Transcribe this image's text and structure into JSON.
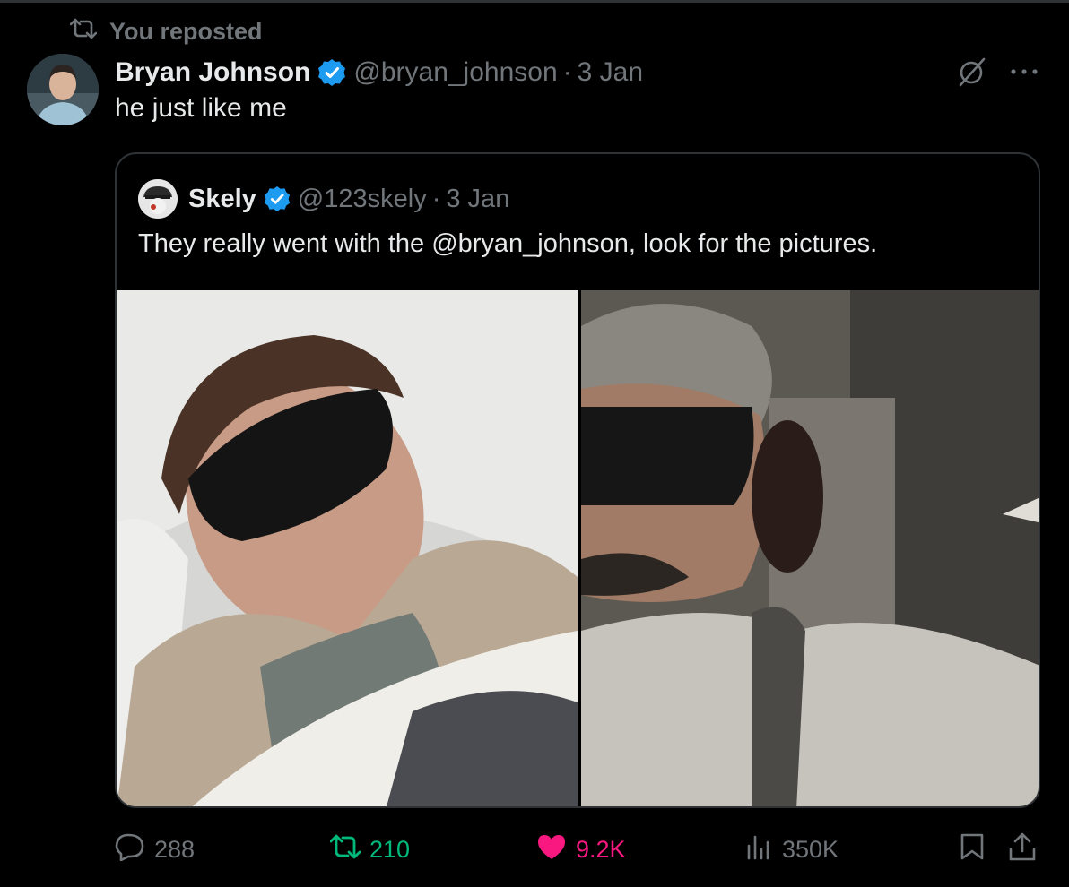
{
  "repost": {
    "label": "You reposted",
    "icon": "repost-icon"
  },
  "tweet": {
    "author_name": "Bryan Johnson",
    "author_handle": "@bryan_johnson",
    "separator": "·",
    "date": "3 Jan",
    "text": "he just like me"
  },
  "quoted": {
    "author_name": "Skely",
    "author_handle": "@123skely",
    "separator": "·",
    "date": "3 Jan",
    "text": "They really went with the @bryan_johnson,  look for the pictures."
  },
  "actions": {
    "replies": "288",
    "reposts": "210",
    "likes": "9.2K",
    "views": "350K"
  },
  "colors": {
    "background": "#000000",
    "text": "#e7e9ea",
    "muted": "#71767b",
    "verified": "#1d9bf0",
    "repost_active": "#00ba7c",
    "like_active": "#f91880",
    "border": "#2f3336"
  }
}
